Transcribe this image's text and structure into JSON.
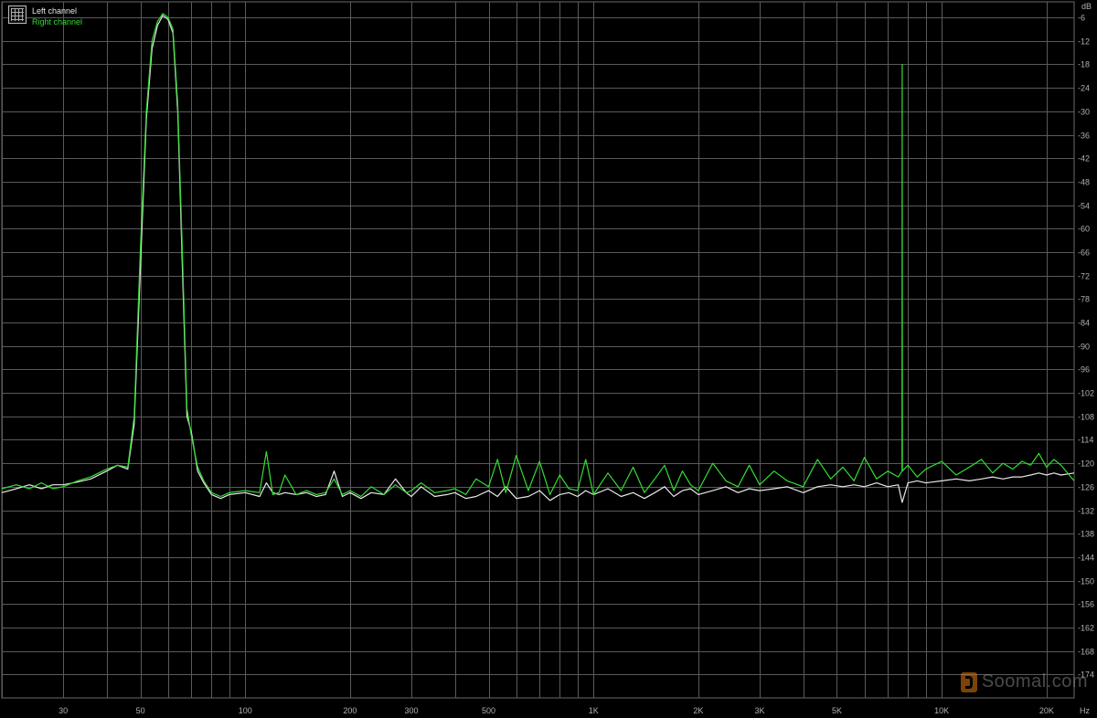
{
  "chart_data": {
    "type": "line",
    "title": "",
    "xlabel": "",
    "ylabel": "",
    "x_unit_label": "Hz",
    "y_unit_label": "dB",
    "x_scale": "log",
    "xlim": [
      20,
      24000
    ],
    "ylim": [
      -180,
      -2
    ],
    "grid": true,
    "legend_placement": "top-left",
    "x_ticks": [
      {
        "value": 30,
        "label": "30"
      },
      {
        "value": 50,
        "label": "50"
      },
      {
        "value": 100,
        "label": "100"
      },
      {
        "value": 200,
        "label": "200"
      },
      {
        "value": 300,
        "label": "300"
      },
      {
        "value": 500,
        "label": "500"
      },
      {
        "value": 1000,
        "label": "1K"
      },
      {
        "value": 2000,
        "label": "2K"
      },
      {
        "value": 3000,
        "label": "3K"
      },
      {
        "value": 5000,
        "label": "5K"
      },
      {
        "value": 10000,
        "label": "10K"
      },
      {
        "value": 20000,
        "label": "20K"
      }
    ],
    "x_grid": [
      20,
      30,
      40,
      50,
      60,
      70,
      80,
      90,
      100,
      200,
      300,
      400,
      500,
      600,
      700,
      800,
      900,
      1000,
      2000,
      3000,
      4000,
      5000,
      6000,
      7000,
      8000,
      9000,
      10000,
      20000
    ],
    "y_ticks": [
      -6,
      -12,
      -18,
      -24,
      -30,
      -36,
      -42,
      -48,
      -54,
      -60,
      -66,
      -72,
      -78,
      -84,
      -90,
      -96,
      -102,
      -108,
      -114,
      -120,
      -126,
      -132,
      -138,
      -144,
      -150,
      -156,
      -162,
      -168,
      -174
    ],
    "series": [
      {
        "name": "Left channel",
        "color": "#e8e8e8",
        "x": [
          20,
          22,
          24,
          26,
          28,
          30,
          33,
          36,
          40,
          43,
          46,
          48,
          50,
          52,
          54,
          56,
          58,
          60,
          62,
          64,
          66,
          68,
          70,
          73,
          76,
          80,
          85,
          90,
          100,
          110,
          115,
          120,
          125,
          130,
          140,
          150,
          160,
          170,
          180,
          190,
          200,
          215,
          230,
          250,
          270,
          290,
          300,
          320,
          350,
          380,
          400,
          430,
          460,
          500,
          530,
          560,
          600,
          650,
          700,
          750,
          800,
          850,
          900,
          950,
          1000,
          1100,
          1200,
          1300,
          1400,
          1500,
          1600,
          1700,
          1800,
          1900,
          2000,
          2200,
          2400,
          2600,
          2800,
          3000,
          3300,
          3600,
          4000,
          4400,
          4800,
          5200,
          5600,
          6000,
          6500,
          7000,
          7500,
          7700,
          8000,
          8500,
          9000,
          10000,
          11000,
          12000,
          13000,
          14000,
          15000,
          16000,
          17000,
          18000,
          19000,
          20000,
          21000,
          22000,
          24000
        ],
        "y": [
          -127.5,
          -126.5,
          -125.5,
          -126.5,
          -125.5,
          -125.5,
          -124.8,
          -124.0,
          -122.0,
          -120.5,
          -121.5,
          -110.0,
          -70.0,
          -32.0,
          -14.0,
          -8.0,
          -5.5,
          -6.5,
          -10.0,
          -30.0,
          -70.0,
          -108.0,
          -112.0,
          -122.0,
          -125.0,
          -128.0,
          -129.0,
          -128.0,
          -127.5,
          -128.5,
          -125.0,
          -127.5,
          -128.0,
          -127.5,
          -128.0,
          -127.5,
          -128.5,
          -128.0,
          -122.0,
          -128.5,
          -127.5,
          -129.0,
          -127.5,
          -128.0,
          -124.0,
          -127.5,
          -128.5,
          -126.0,
          -128.5,
          -128.0,
          -127.5,
          -129.0,
          -128.5,
          -127.0,
          -128.5,
          -126.0,
          -129.0,
          -128.5,
          -127.0,
          -129.5,
          -128.0,
          -127.5,
          -128.5,
          -127.0,
          -128.0,
          -126.5,
          -128.5,
          -127.5,
          -129.0,
          -127.5,
          -126.0,
          -128.5,
          -127.0,
          -126.5,
          -128.0,
          -127.0,
          -126.0,
          -127.5,
          -126.5,
          -127.0,
          -126.5,
          -126.0,
          -127.5,
          -126.0,
          -125.5,
          -126.0,
          -125.5,
          -126.0,
          -125.0,
          -126.0,
          -125.5,
          -130.0,
          -125.0,
          -124.5,
          -125.0,
          -124.5,
          -124.0,
          -124.5,
          -124.0,
          -123.5,
          -124.0,
          -123.5,
          -123.5,
          -123.0,
          -122.5,
          -123.0,
          -122.5,
          -123.0,
          -122.5
        ]
      },
      {
        "name": "Right channel",
        "color": "#33dd33",
        "x": [
          20,
          22,
          24,
          26,
          28,
          30,
          33,
          36,
          40,
          43,
          46,
          48,
          50,
          52,
          54,
          56,
          58,
          60,
          62,
          64,
          66,
          68,
          70,
          73,
          76,
          80,
          85,
          90,
          100,
          110,
          115,
          120,
          125,
          130,
          140,
          150,
          160,
          170,
          180,
          190,
          200,
          215,
          230,
          250,
          270,
          290,
          300,
          320,
          350,
          380,
          400,
          430,
          460,
          500,
          530,
          560,
          600,
          650,
          700,
          750,
          800,
          850,
          900,
          950,
          1000,
          1100,
          1200,
          1300,
          1400,
          1500,
          1600,
          1700,
          1800,
          1900,
          2000,
          2200,
          2400,
          2600,
          2800,
          3000,
          3300,
          3600,
          4000,
          4400,
          4800,
          5200,
          5600,
          6000,
          6500,
          7000,
          7500,
          7690,
          7700,
          7710,
          8000,
          8500,
          9000,
          10000,
          11000,
          12000,
          13000,
          14000,
          15000,
          16000,
          17000,
          18000,
          19000,
          20000,
          21000,
          22000,
          24000
        ],
        "y": [
          -126.5,
          -125.5,
          -126.5,
          -125.0,
          -126.5,
          -126.0,
          -124.5,
          -123.5,
          -121.5,
          -120.5,
          -121.0,
          -108.0,
          -65.0,
          -30.0,
          -12.0,
          -7.0,
          -5.0,
          -6.0,
          -9.0,
          -28.0,
          -66.0,
          -106.0,
          -113.0,
          -121.0,
          -124.5,
          -127.5,
          -128.5,
          -127.5,
          -127.0,
          -127.5,
          -117.0,
          -128.0,
          -127.5,
          -123.0,
          -128.0,
          -127.0,
          -128.0,
          -127.5,
          -124.0,
          -128.0,
          -127.0,
          -128.5,
          -126.0,
          -128.0,
          -125.5,
          -127.5,
          -127.0,
          -125.0,
          -127.5,
          -127.0,
          -126.5,
          -128.0,
          -124.0,
          -126.0,
          -119.0,
          -127.5,
          -118.0,
          -127.0,
          -119.5,
          -128.0,
          -123.0,
          -126.5,
          -127.0,
          -119.0,
          -128.0,
          -122.5,
          -127.0,
          -121.0,
          -127.5,
          -124.0,
          -120.5,
          -127.0,
          -122.0,
          -125.5,
          -127.0,
          -120.0,
          -124.5,
          -126.0,
          -120.5,
          -125.5,
          -122.0,
          -124.5,
          -126.0,
          -119.0,
          -124.0,
          -121.0,
          -124.5,
          -118.5,
          -124.0,
          -122.0,
          -123.5,
          -122.0,
          -18.0,
          -122.0,
          -120.5,
          -123.5,
          -121.5,
          -119.5,
          -123.0,
          -121.0,
          -119.0,
          -122.5,
          -120.0,
          -121.5,
          -119.5,
          -120.5,
          -117.5,
          -121.0,
          -119.0,
          -120.5,
          -124.5
        ]
      }
    ]
  },
  "legend": {
    "left_label": "Left channel",
    "right_label": "Right channel"
  },
  "axes": {
    "y_unit": "dB",
    "x_unit": "Hz"
  },
  "watermark": {
    "text": "Soomal.com"
  }
}
